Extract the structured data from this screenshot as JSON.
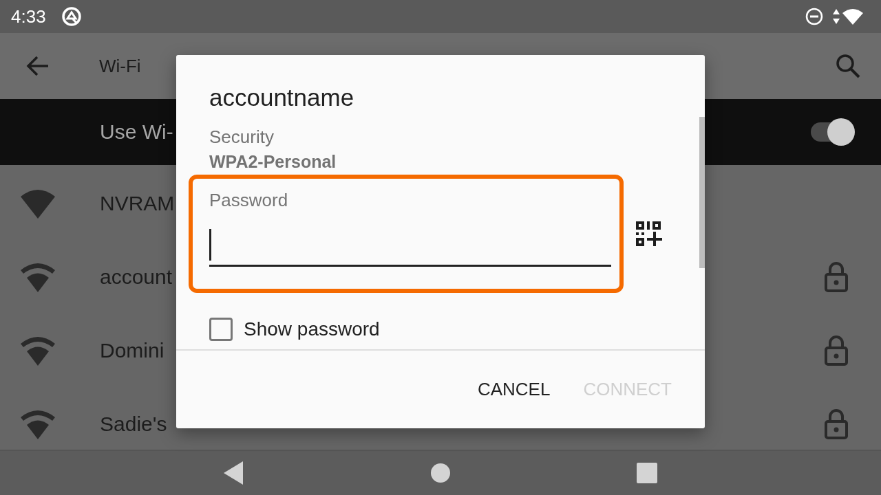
{
  "status_bar": {
    "time": "4:33"
  },
  "toolbar": {
    "title": "Wi-Fi"
  },
  "wifi_switch": {
    "label": "Use Wi-",
    "on": true
  },
  "networks": [
    {
      "name": "NVRAM",
      "secured": false
    },
    {
      "name": "account",
      "secured": true
    },
    {
      "name": "Domini",
      "secured": true
    },
    {
      "name": "Sadie's",
      "secured": true
    }
  ],
  "dialog": {
    "title": "accountname",
    "security_label": "Security",
    "security_value": "WPA2-Personal",
    "password": {
      "label": "Password",
      "highlighted": true
    },
    "show_password": {
      "label": "Show password",
      "checked": false
    },
    "buttons": [
      {
        "label": "CANCEL",
        "disabled": false
      },
      {
        "label": "CONNECT",
        "disabled": true
      }
    ]
  }
}
